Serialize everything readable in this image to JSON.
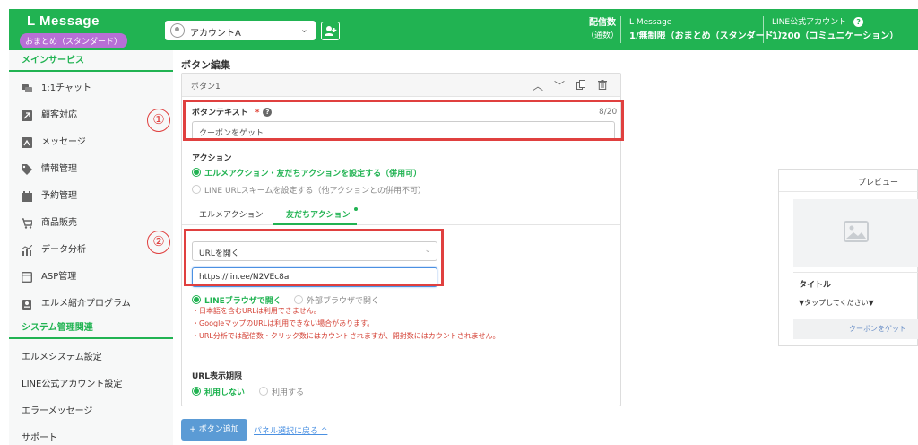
{
  "header": {
    "brand": "L Message",
    "plan_badge": "おまとめ（スタンダード）",
    "account_name": "アカウントA",
    "deliveries_label": "配信数",
    "deliveries_sub": "（通数）",
    "lmessage_label": "L Message",
    "lmessage_value": "1/無制限（おまとめ（スタンダード））",
    "line_account_label": "LINE公式アカウント",
    "line_account_value": "1/200（コミュニケーション）",
    "help_icon": "question-circle-icon",
    "brand_color": "#21b352"
  },
  "sidebar": {
    "main_section": "メインサービス",
    "items": [
      {
        "label": "1:1チャット",
        "icon": "chat-icon"
      },
      {
        "label": "顧客対応",
        "icon": "customer-icon"
      },
      {
        "label": "メッセージ",
        "icon": "message-icon"
      },
      {
        "label": "情報管理",
        "icon": "tag-icon"
      },
      {
        "label": "予約管理",
        "icon": "calendar-icon"
      },
      {
        "label": "商品販売",
        "icon": "cart-icon"
      },
      {
        "label": "データ分析",
        "icon": "chart-icon"
      },
      {
        "label": "ASP管理",
        "icon": "asp-icon"
      },
      {
        "label": "エルメ紹介プログラム",
        "icon": "referral-icon"
      }
    ],
    "system_section": "システム管理関連",
    "system_items": [
      "エルメシステム設定",
      "LINE公式アカウント設定",
      "エラーメッセージ",
      "サポート"
    ]
  },
  "main": {
    "page_title": "ボタン編集",
    "card_title": "ボタン1",
    "button_text_label": "ボタンテキスト",
    "required_mark": "*",
    "char_count": "8/20",
    "button_text_value": "クーポンをゲット",
    "action_label": "アクション",
    "action_option_1": "エルメアクション・友だちアクションを設定する（併用可）",
    "action_option_2": "LINE URLスキームを設定する（他アクションとの併用不可）",
    "tab_1": "エルメアクション",
    "tab_2": "友だちアクション",
    "url_select": "URLを開く",
    "url_value": "https://lin.ee/N2VEc8a",
    "browser_option_1": "LINEブラウザで開く",
    "browser_option_2": "外部ブラウザで開く",
    "notes": [
      "・日本語を含むURLは利用できません。",
      "・GoogleマップのURLは利用できない場合があります。",
      "・URL分析では配信数・クリック数にはカウントされますが、開封数にはカウントされません。"
    ],
    "expiry_label": "URL表示期限",
    "expiry_option_1": "利用しない",
    "expiry_option_2": "利用する",
    "add_button": "+ ボタン追加",
    "back_link": "パネル選択に戻る ^",
    "annotation_1": "①",
    "annotation_2": "②",
    "annotation_color": "#e0403f"
  },
  "preview": {
    "header": "プレビュー",
    "title": "タイトル",
    "description": "▼タップしてください▼",
    "button_label": "クーポンをゲット"
  }
}
